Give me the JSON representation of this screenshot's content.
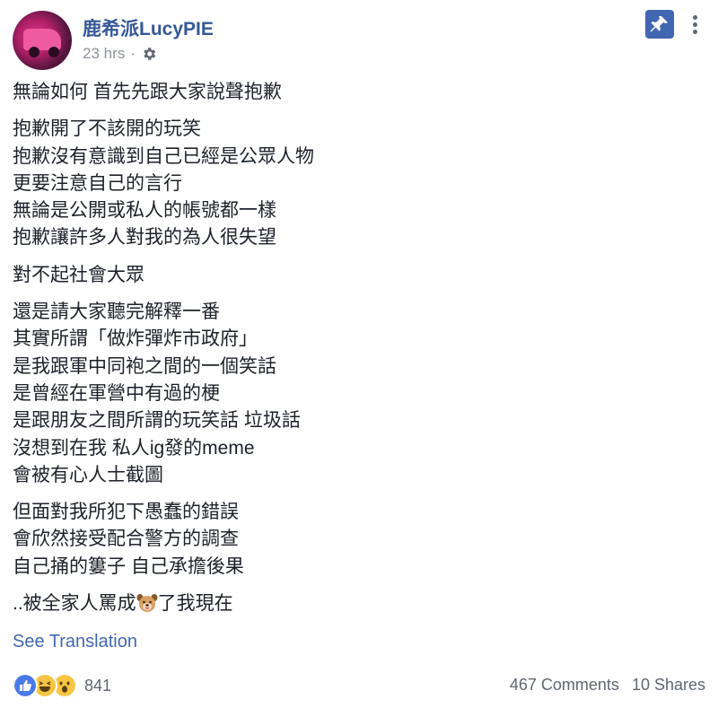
{
  "post": {
    "author": "鹿希派LucyPIE",
    "timestamp": "23 hrs",
    "privacy_icon": "gear-icon",
    "pin_icon": "pin-icon",
    "more_icon": "more-horizontal-icon"
  },
  "body": {
    "paragraphs": [
      [
        "無論如何 首先先跟大家說聲抱歉"
      ],
      [
        "抱歉開了不該開的玩笑",
        "抱歉沒有意識到自己已經是公眾人物",
        "更要注意自己的言行",
        "無論是公開或私人的帳號都一樣",
        "抱歉讓許多人對我的為人很失望"
      ],
      [
        "對不起社會大眾"
      ],
      [
        "還是請大家聽完解釋一番",
        "其實所謂「做炸彈炸市政府」",
        "是我跟軍中同袍之間的一個笑話",
        "是曾經在軍營中有過的梗",
        "是跟朋友之間所謂的玩笑話 垃圾話",
        "沒想到在我 私人ig發的meme",
        "會被有心人士截圖"
      ],
      [
        "但面對我所犯下愚蠢的錯誤",
        "會欣然接受配合警方的調查",
        "自己捅的簍子 自己承擔後果"
      ]
    ],
    "last_line_prefix": "..被全家人罵成",
    "last_line_emoji": "dog-face-emoji",
    "last_line_suffix": "了我現在"
  },
  "see_translation": "See Translation",
  "footer": {
    "reaction_icons": [
      "like-icon",
      "haha-icon",
      "wow-icon"
    ],
    "reaction_count": "841",
    "comments": "467 Comments",
    "shares": "10 Shares"
  },
  "colors": {
    "link_blue": "#365899",
    "brand_blue": "#4267b2",
    "meta_gray": "#90949c",
    "text": "#1d2129"
  }
}
